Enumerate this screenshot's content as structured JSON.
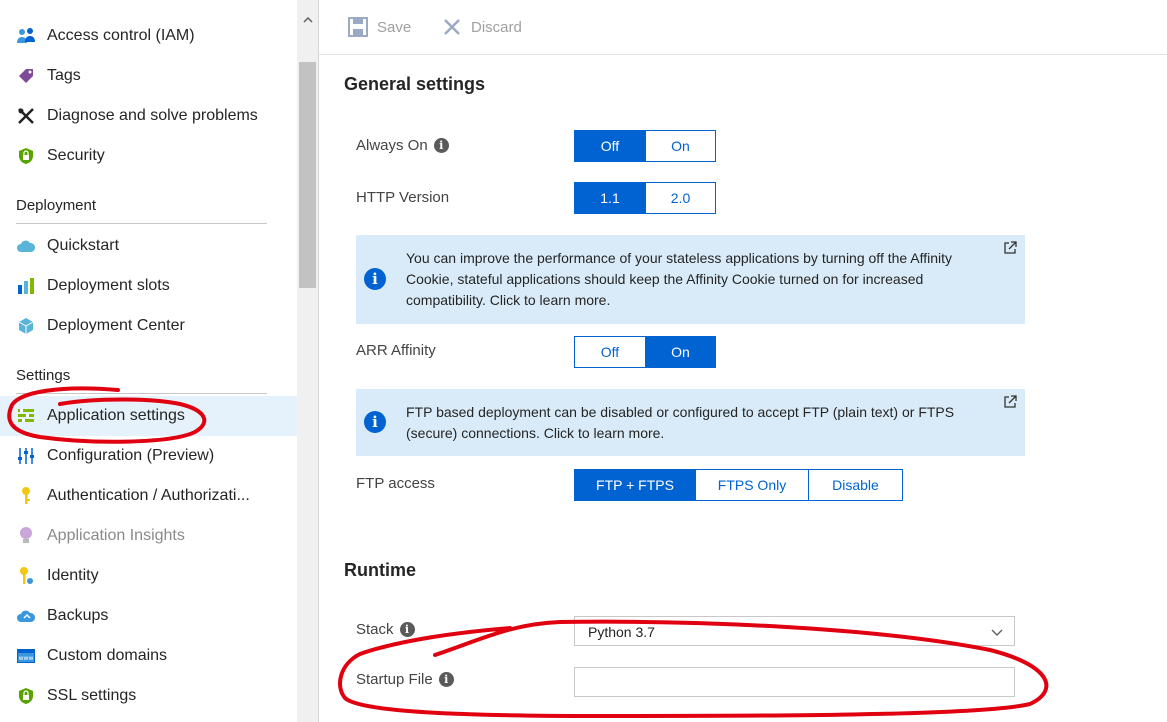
{
  "sidebar": {
    "items_top": [
      {
        "label": "Access control (IAM)",
        "icon": "people-icon"
      },
      {
        "label": "Tags",
        "icon": "tag-icon"
      },
      {
        "label": "Diagnose and solve problems",
        "icon": "wrench-icon"
      },
      {
        "label": "Security",
        "icon": "shield-icon"
      }
    ],
    "deployment_title": "Deployment",
    "deployment_items": [
      {
        "label": "Quickstart",
        "icon": "cloud-icon"
      },
      {
        "label": "Deployment slots",
        "icon": "slots-icon"
      },
      {
        "label": "Deployment Center",
        "icon": "cube-icon"
      }
    ],
    "settings_title": "Settings",
    "settings_items": [
      {
        "label": "Application settings",
        "icon": "app-settings-icon",
        "selected": true
      },
      {
        "label": "Configuration (Preview)",
        "icon": "sliders-icon"
      },
      {
        "label": "Authentication / Authorizati...",
        "icon": "key-icon"
      },
      {
        "label": "Application Insights",
        "icon": "lightbulb-icon",
        "disabled": true
      },
      {
        "label": "Identity",
        "icon": "identity-key-icon"
      },
      {
        "label": "Backups",
        "icon": "backup-cloud-icon"
      },
      {
        "label": "Custom domains",
        "icon": "www-icon"
      },
      {
        "label": "SSL settings",
        "icon": "ssl-shield-icon"
      }
    ]
  },
  "toolbar": {
    "save_label": "Save",
    "discard_label": "Discard"
  },
  "general": {
    "heading": "General settings",
    "always_on": {
      "label": "Always On",
      "options": [
        "Off",
        "On"
      ],
      "selected": "Off"
    },
    "http_version": {
      "label": "HTTP Version",
      "options": [
        "1.1",
        "2.0"
      ],
      "selected": "1.1"
    },
    "affinity_info": "You can improve the performance of your stateless applications by turning off the Affinity Cookie, stateful applications should keep the Affinity Cookie turned on for increased compatibility. Click to learn more.",
    "arr_affinity": {
      "label": "ARR Affinity",
      "options": [
        "Off",
        "On"
      ],
      "selected": "On"
    },
    "ftp_info": "FTP based deployment can be disabled or configured to accept FTP (plain text) or FTPS (secure) connections. Click to learn more.",
    "ftp_access": {
      "label": "FTP access",
      "options": [
        "FTP + FTPS",
        "FTPS Only",
        "Disable"
      ],
      "selected": "FTP + FTPS"
    }
  },
  "runtime": {
    "heading": "Runtime",
    "stack_label": "Stack",
    "stack_value": "Python 3.7",
    "startup_label": "Startup File",
    "startup_value": ""
  },
  "colors": {
    "accent": "#0063d1",
    "info_bg": "#d9ebf8",
    "selected_nav": "#e5f1fb",
    "annotation": "#e0000f"
  }
}
